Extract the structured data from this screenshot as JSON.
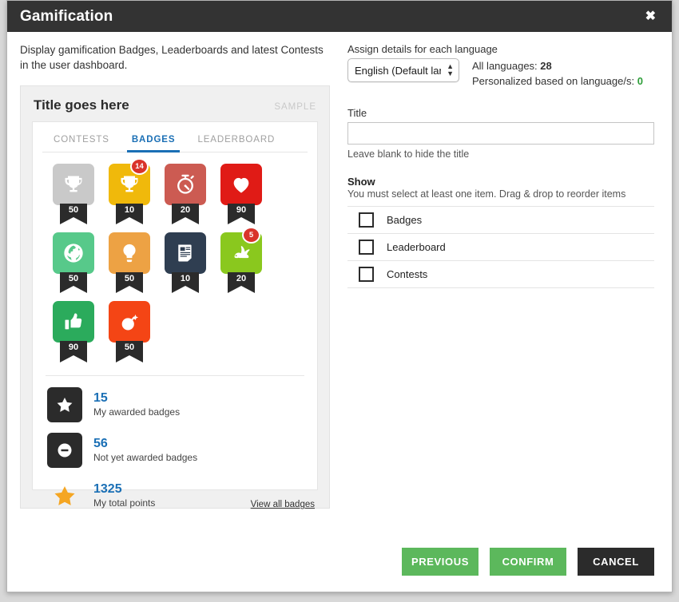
{
  "window": {
    "title": "Gamification",
    "close_label": "✖"
  },
  "left": {
    "intro": "Display gamification Badges, Leaderboards and latest Contests in the user dashboard.",
    "preview": {
      "title": "Title goes here",
      "sample_label": "SAMPLE",
      "tabs": [
        {
          "label": "CONTESTS",
          "active": false
        },
        {
          "label": "BADGES",
          "active": true
        },
        {
          "label": "LEADERBOARD",
          "active": false
        }
      ],
      "badges": [
        {
          "icon": "trophy-icon",
          "color": "#c9c9c9",
          "points": "50",
          "count": null
        },
        {
          "icon": "trophy-icon",
          "color": "#f0b90b",
          "points": "10",
          "count": "14"
        },
        {
          "icon": "stopwatch-icon",
          "color": "#cc5b52",
          "points": "20",
          "count": null
        },
        {
          "icon": "heart-icon",
          "color": "#e01b16",
          "points": "90",
          "count": null
        },
        {
          "icon": "globe-icon",
          "color": "#57c98a",
          "points": "50",
          "count": null
        },
        {
          "icon": "lightbulb-icon",
          "color": "#eda244",
          "points": "50",
          "count": null
        },
        {
          "icon": "news-icon",
          "color": "#2f3e51",
          "points": "10",
          "count": null
        },
        {
          "icon": "rabbit-icon",
          "color": "#8ac81e",
          "points": "20",
          "count": "5"
        },
        {
          "icon": "thumbs-up-icon",
          "color": "#2bab5c",
          "points": "90",
          "count": null
        },
        {
          "icon": "bomb-icon",
          "color": "#f44515",
          "points": "50",
          "count": null
        }
      ],
      "stats": [
        {
          "icon": "star-icon",
          "style": "dark",
          "value": "15",
          "label": "My awarded badges"
        },
        {
          "icon": "minus-circle-icon",
          "style": "dark",
          "value": "56",
          "label": "Not yet awarded badges"
        },
        {
          "icon": "star-icon",
          "style": "plain-gold",
          "value": "1325",
          "label": "My total points"
        }
      ],
      "view_all_link": "View all badges"
    }
  },
  "right": {
    "language": {
      "heading": "Assign details for each language",
      "selected": "English (Default language)",
      "all_languages_label": "All languages:",
      "all_languages_value": "28",
      "personalized_label": "Personalized based on language/s:",
      "personalized_value": "0",
      "personalized_color": "#2e9e39"
    },
    "title_field": {
      "label": "Title",
      "value": "",
      "placeholder": "",
      "hint": "Leave blank to hide the title"
    },
    "show": {
      "heading": "Show",
      "subtext": "You must select at least one item. Drag & drop to reorder items",
      "items": [
        {
          "label": "Badges",
          "checked": false
        },
        {
          "label": "Leaderboard",
          "checked": false
        },
        {
          "label": "Contests",
          "checked": false
        }
      ]
    }
  },
  "footer": {
    "previous": "PREVIOUS",
    "confirm": "CONFIRM",
    "cancel": "CANCEL",
    "green": "#5cb85c",
    "dark": "#2b2b2b"
  }
}
